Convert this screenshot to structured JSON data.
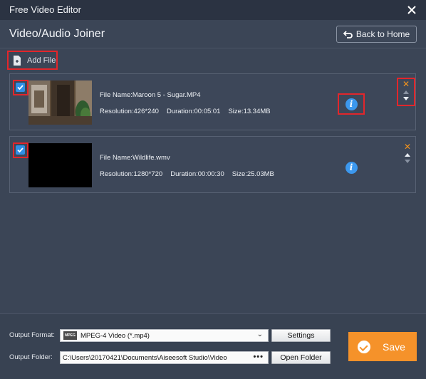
{
  "window": {
    "title": "Free Video Editor"
  },
  "header": {
    "page_title": "Video/Audio Joiner",
    "back_label": "Back to Home"
  },
  "toolbar": {
    "add_file_label": "Add File"
  },
  "files": [
    {
      "checked": true,
      "name": "File Name:Maroon 5 - Sugar.MP4",
      "resolution": "Resolution:426*240",
      "duration": "Duration:00:05:01",
      "size": "Size:13.34MB"
    },
    {
      "checked": true,
      "name": "File Name:Wildlife.wmv",
      "resolution": "Resolution:1280*720",
      "duration": "Duration:00:00:30",
      "size": "Size:25.03MB"
    }
  ],
  "output": {
    "format_label": "Output Format:",
    "format_value": "MPEG-4 Video (*.mp4)",
    "format_icon_text": "MPEG",
    "settings_label": "Settings",
    "folder_label": "Output Folder:",
    "folder_value": "C:\\Users\\20170421\\Documents\\Aiseesoft Studio\\Video",
    "folder_browse": "•••",
    "open_folder_label": "Open Folder",
    "save_label": "Save"
  },
  "colors": {
    "background": "#3b4556",
    "titlebar": "#2b3342",
    "accent_orange": "#f5922a",
    "checkbox_blue": "#2f8fe6",
    "highlight_red": "#e2262b"
  }
}
